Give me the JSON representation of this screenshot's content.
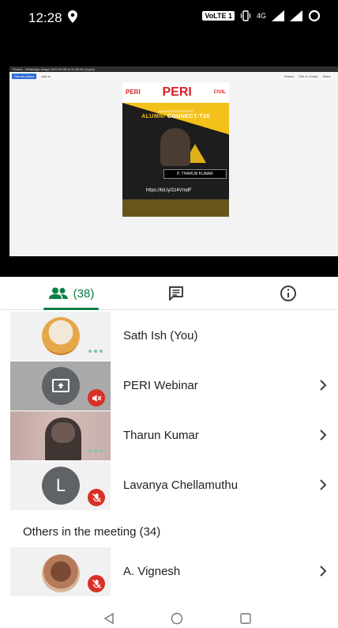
{
  "status_bar": {
    "time": "12:28",
    "volte": "VoLTE 1",
    "network": "4G"
  },
  "presentation": {
    "window_title": "Photos - WhatsApp Image 2020-09-08 at 11.28.06 (4).jpeg",
    "toolbar_left": [
      "See all photos",
      "Add to"
    ],
    "toolbar_right": [
      "Search",
      "Edit & Create",
      "Share"
    ],
    "poster": {
      "org_left": "PERI",
      "org_center": "PERI",
      "org_right": "CIVIL",
      "subtitle": "INAUGURATING EVENT",
      "title_part1": "ALUMNI",
      "title_part2": "CONNECT-T20",
      "speaker": "P. THARUN KUMAR",
      "link": "https://bit.ly/2z4VmdF"
    }
  },
  "tabs": {
    "people_count": "(38)"
  },
  "participants": [
    {
      "name": "Sath Ish (You)",
      "state": "speaking",
      "has_chevron": false
    },
    {
      "name": "PERI Webinar",
      "state": "presenting-muted",
      "has_chevron": true
    },
    {
      "name": "Tharun Kumar",
      "state": "video-speaking",
      "has_chevron": true
    },
    {
      "name": "Lavanya Chellamuthu",
      "avatar_letter": "L",
      "state": "muted",
      "has_chevron": true
    }
  ],
  "others_section": {
    "title": "Others in the meeting (34)",
    "participants": [
      {
        "name": "A. Vignesh",
        "state": "muted",
        "has_chevron": true
      }
    ]
  },
  "colors": {
    "accent_green": "#0b8043",
    "mute_red": "#d93025",
    "avatar_grey": "#5f6368"
  }
}
